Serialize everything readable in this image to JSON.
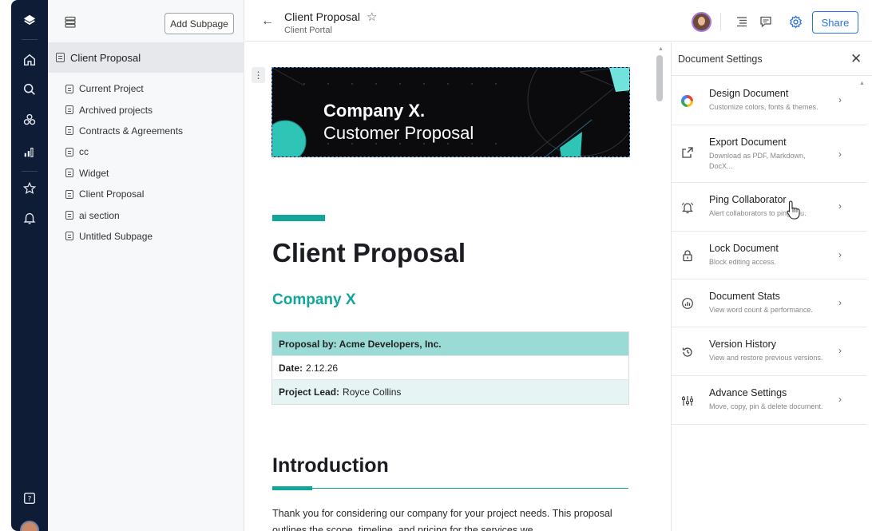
{
  "tree": {
    "add_subpage": "Add Subpage",
    "active_page": "Client Proposal",
    "pages": [
      "Current Project",
      "Archived projects",
      "Contracts & Agreements",
      "cc",
      "Widget",
      "Client Proposal",
      "ai section",
      "Untitled Subpage"
    ]
  },
  "header": {
    "title": "Client Proposal",
    "subtitle": "Client Portal",
    "share_label": "Share"
  },
  "doc": {
    "banner_title": "Company X.",
    "banner_subtitle": "Customer Proposal",
    "heading": "Client Proposal",
    "company": "Company X",
    "table": {
      "row1": "Proposal by: Acme Developers, Inc.",
      "row2_label": "Date:",
      "row2_value": "2.12.26",
      "row3_label": "Project Lead:",
      "row3_value": "Royce Collins"
    },
    "section_title": "Introduction",
    "intro": "Thank you for considering our company for your project needs. This proposal outlines the scope, timeline, and pricing for the services we"
  },
  "panel": {
    "title": "Document Settings",
    "items": [
      {
        "title": "Design Document",
        "desc": "Customize colors, fonts & themes.",
        "icon": "palette-ring-icon"
      },
      {
        "title": "Export Document",
        "desc": "Download as PDF, Markdown, DocX...",
        "icon": "export-icon"
      },
      {
        "title": "Ping Collaborator",
        "desc": "Alert collaborators to ping you.",
        "icon": "bell-icon"
      },
      {
        "title": "Lock Document",
        "desc": "Block editing access.",
        "icon": "lock-icon"
      },
      {
        "title": "Document Stats",
        "desc": "View word count & performance.",
        "icon": "stats-icon"
      },
      {
        "title": "Version History",
        "desc": "View and restore previous versions.",
        "icon": "history-icon"
      },
      {
        "title": "Advance Settings",
        "desc": "Move, copy, pin & delete document.",
        "icon": "sliders-icon"
      }
    ]
  },
  "colors": {
    "rail": "#0f1c36",
    "accent_teal": "#12a59b",
    "share_blue": "#2b74d8"
  }
}
